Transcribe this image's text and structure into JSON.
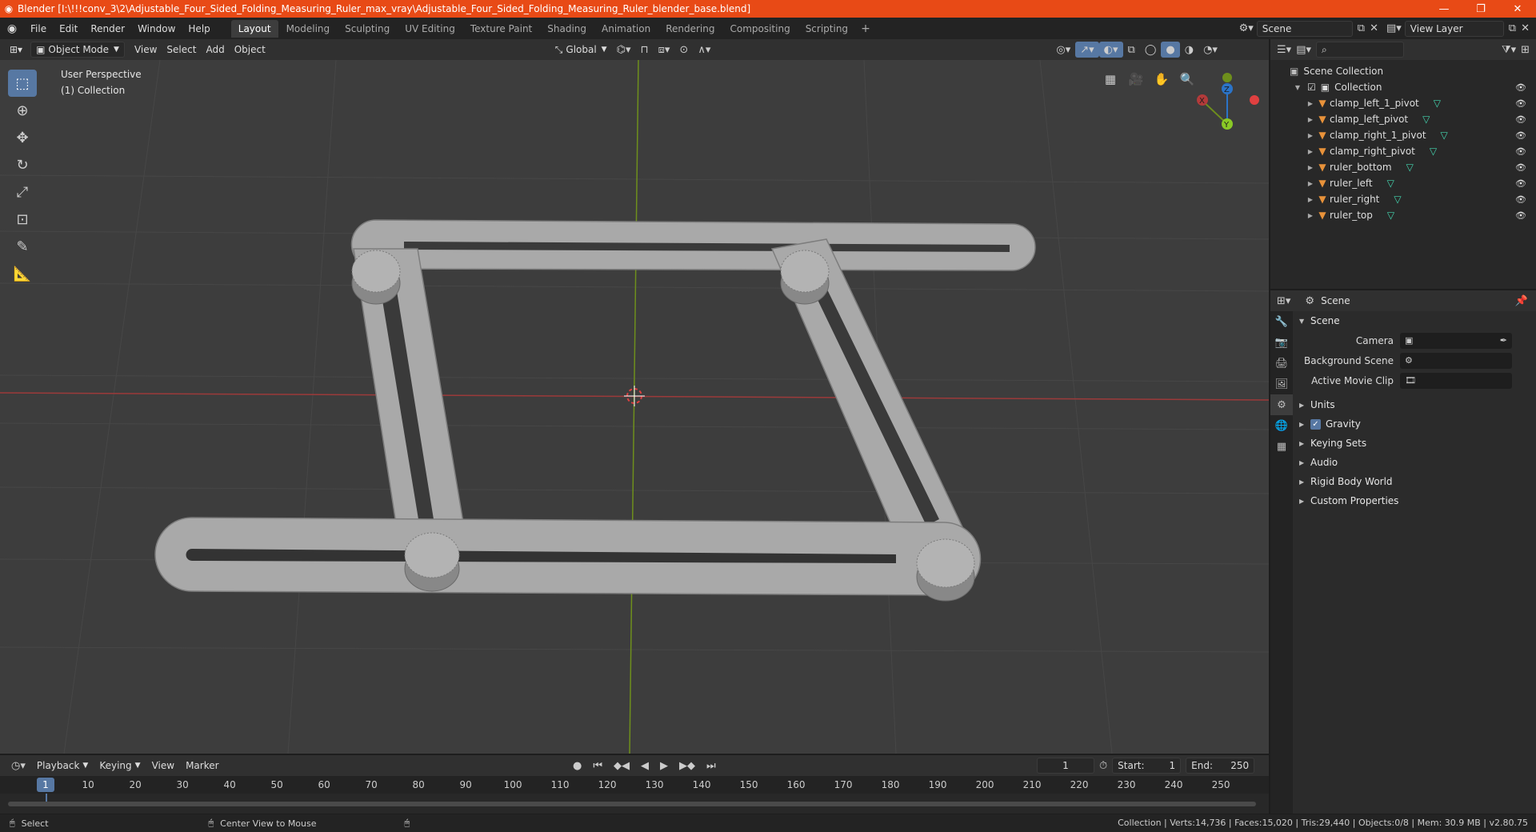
{
  "window": {
    "title": "Blender [I:\\!!!conv_3\\2\\Adjustable_Four_Sided_Folding_Measuring_Ruler_max_vray\\Adjustable_Four_Sided_Folding_Measuring_Ruler_blender_base.blend]",
    "minimize": "—",
    "maximize": "❐",
    "close": "✕"
  },
  "menubar": {
    "menus": [
      "File",
      "Edit",
      "Render",
      "Window",
      "Help"
    ],
    "workspaces": [
      "Layout",
      "Modeling",
      "Sculpting",
      "UV Editing",
      "Texture Paint",
      "Shading",
      "Animation",
      "Rendering",
      "Compositing",
      "Scripting"
    ],
    "active_workspace": "Layout",
    "add_workspace": "+",
    "scene": "Scene",
    "view_layer": "View Layer"
  },
  "viewport": {
    "mode": "Object Mode",
    "menus": [
      "View",
      "Select",
      "Add",
      "Object"
    ],
    "orientation": "Global",
    "perspective": "User Perspective",
    "collection": "(1) Collection",
    "gizmo_axes": {
      "x": "X",
      "y": "Y",
      "z": "Z"
    }
  },
  "outliner": {
    "root": "Scene Collection",
    "collection": "Collection",
    "objects": [
      "clamp_left_1_pivot",
      "clamp_left_pivot",
      "clamp_right_1_pivot",
      "clamp_right_pivot",
      "ruler_bottom",
      "ruler_left",
      "ruler_right",
      "ruler_top"
    ]
  },
  "properties": {
    "context": "Scene",
    "panel": "Scene",
    "fields": [
      {
        "label": "Camera",
        "value": ""
      },
      {
        "label": "Background Scene",
        "value": ""
      },
      {
        "label": "Active Movie Clip",
        "value": ""
      }
    ],
    "subpanels": [
      "Units",
      "Gravity",
      "Keying Sets",
      "Audio",
      "Rigid Body World",
      "Custom Properties"
    ],
    "gravity_enabled": true
  },
  "timeline": {
    "menus": [
      "Playback",
      "Keying",
      "View",
      "Marker"
    ],
    "current_frame": "1",
    "start_label": "Start:",
    "start": "1",
    "end_label": "End:",
    "end": "250",
    "ticks": [
      "1",
      "10",
      "20",
      "30",
      "40",
      "50",
      "60",
      "70",
      "80",
      "90",
      "100",
      "110",
      "120",
      "130",
      "140",
      "150",
      "160",
      "170",
      "180",
      "190",
      "200",
      "210",
      "220",
      "230",
      "240",
      "250"
    ]
  },
  "statusbar": {
    "select": "Select",
    "center_view": "Center View to Mouse",
    "stats": "Collection | Verts:14,736 | Faces:15,020 | Tris:29,440 | Objects:0/8 | Mem: 30.9 MB | v2.80.75"
  },
  "colors": {
    "title_bar": "#e84a16",
    "viewport_bg": "#3d3d3d",
    "axis_x": "#b33a3a",
    "axis_y": "#7ba01c",
    "selection": "#5778a3",
    "object_icon": "#e8923a",
    "mesh_icon": "#44d6b0"
  }
}
